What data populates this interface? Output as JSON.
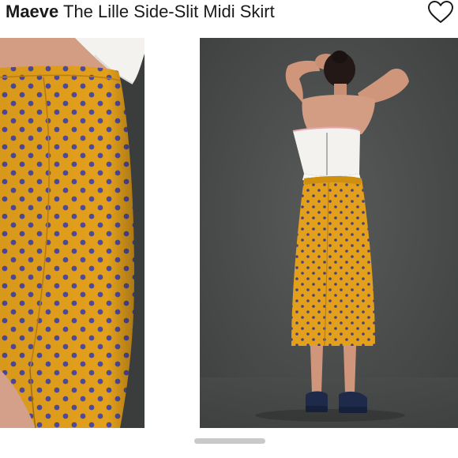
{
  "header": {
    "brand": "Maeve",
    "product_name": "The Lille Side-Slit Midi Skirt"
  },
  "icons": {
    "favorite": "heart-icon"
  },
  "gallery": {
    "images": [
      {
        "name": "skirt-closeup-photo"
      },
      {
        "name": "model-back-view-photo"
      }
    ],
    "colors": {
      "skirt": "#e3a01c",
      "dots": "#4f4a9a",
      "background": "#474a49"
    }
  }
}
